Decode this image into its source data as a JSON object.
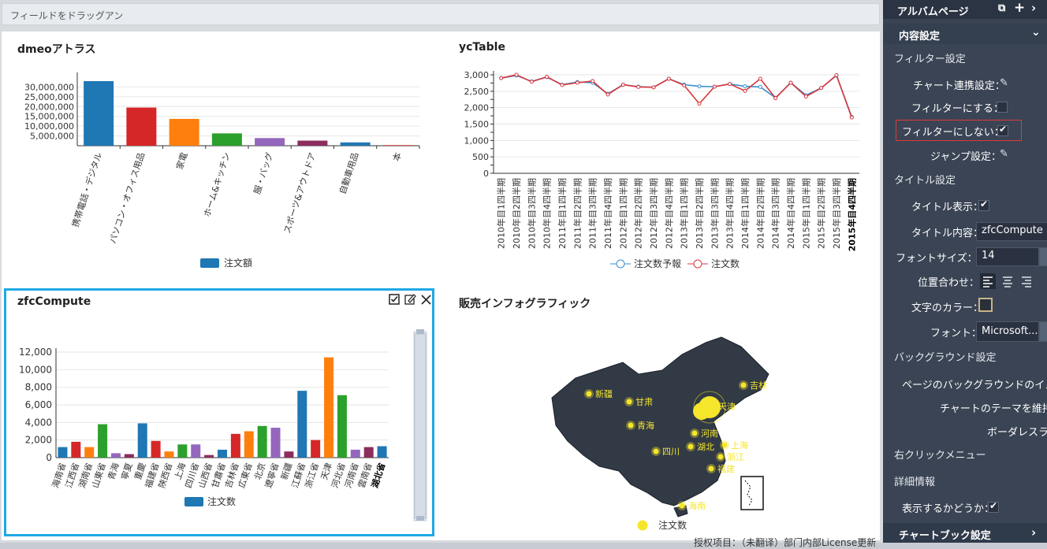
{
  "dropbar": {
    "label": "フィールドをドラッグアン"
  },
  "footer": {
    "text": "授权项目：（未翻译）部门内部License更新"
  },
  "widgets": {
    "w1": {
      "title": "dmeoアトラス",
      "legend": "注文額"
    },
    "w2": {
      "title": "ycTable",
      "legend_a": "注文数予報",
      "legend_b": "注文数"
    },
    "w3": {
      "title": "zfcCompute",
      "legend": "注文数"
    },
    "w4": {
      "title": "販売インフォグラフィック",
      "legend": "注文数"
    }
  },
  "chart_data": [
    {
      "type": "bar",
      "title": "dmeoアトラス",
      "categories": [
        "携帯電話・デジタル",
        "パソコン・オフィス用品",
        "家電",
        "ホーム&キッチン",
        "服・バッグ",
        "スポーツ&アウトドア",
        "自動車用品",
        "本"
      ],
      "values": [
        33000000,
        19500000,
        13700000,
        6300000,
        3900000,
        2600000,
        1700000,
        300000
      ],
      "colors": [
        "#1f77b4",
        "#d62728",
        "#ff7f0e",
        "#2ca02c",
        "#9467bd",
        "#8c2d5e",
        "#1f77b4",
        "#d62728"
      ],
      "yticks": [
        "5,000,000",
        "10,000,000",
        "15,000,000",
        "20,000,000",
        "25,000,000",
        "30,000,000"
      ],
      "ylim": [
        0,
        35000000
      ],
      "legend": [
        "注文額"
      ]
    },
    {
      "type": "line",
      "title": "ycTable",
      "categories": [
        "2010年目1四半期",
        "2010年目2四半期",
        "2010年目3四半期",
        "2010年目4四半期",
        "2011年目1四半期",
        "2011年目2四半期",
        "2011年目3四半期",
        "2011年目4四半期",
        "2012年目1四半期",
        "2012年目2四半期",
        "2012年目3四半期",
        "2012年目4四半期",
        "2013年目1四半期",
        "2013年目2四半期",
        "2013年目3四半期",
        "2013年目4四半期",
        "2014年目1四半期",
        "2014年目2四半期",
        "2014年目3四半期",
        "2014年目4四半期",
        "2015年目1四半期",
        "2015年目2四半期",
        "2015年目3四半期",
        "2015年目4四半期"
      ],
      "yticks": [
        "0",
        "250",
        "500",
        "750",
        "1,000",
        "1,250",
        "1,500",
        "1,750",
        "2,000",
        "2,250",
        "2,500",
        "2,750",
        "3,000"
      ],
      "ylim": [
        0,
        3000
      ],
      "series": [
        {
          "name": "注文数予報",
          "color": "#3a8fd1",
          "values": [
            2900,
            2980,
            2800,
            2930,
            2700,
            2780,
            2760,
            2420,
            2700,
            2640,
            2620,
            2880,
            2700,
            2650,
            2640,
            2720,
            2650,
            2630,
            2300,
            2760,
            2380,
            2600,
            2980,
            1720
          ]
        },
        {
          "name": "注文数",
          "color": "#d9373b",
          "values": [
            2900,
            3000,
            2790,
            2940,
            2690,
            2760,
            2810,
            2400,
            2700,
            2630,
            2620,
            2880,
            2680,
            2120,
            2640,
            2720,
            2510,
            2880,
            2290,
            2760,
            2340,
            2600,
            2990,
            1700
          ]
        }
      ],
      "legend": [
        "注文数予報",
        "注文数"
      ]
    },
    {
      "type": "bar",
      "title": "zfcCompute",
      "categories": [
        "海南省",
        "江西省",
        "湖南省",
        "山東省",
        "青海",
        "寧夏",
        "重慶",
        "福建省",
        "陝西省",
        "上海",
        "四川省",
        "山西省",
        "甘肅省",
        "吉林省",
        "広東省",
        "北京",
        "遼寧省",
        "新疆",
        "江蘇省",
        "浙江省",
        "天津",
        "河北省",
        "河南省",
        "雲南省",
        "湖北省"
      ],
      "values": [
        1200,
        1800,
        1200,
        3800,
        500,
        400,
        3900,
        1900,
        700,
        1500,
        1500,
        300,
        900,
        2700,
        3000,
        3600,
        3400,
        700,
        7600,
        2000,
        11400,
        7100,
        900,
        1200,
        1300
      ],
      "colors": [
        "#1f77b4",
        "#d62728",
        "#ff7f0e",
        "#2ca02c",
        "#9467bd",
        "#8c2d5e",
        "#1f77b4",
        "#d62728",
        "#ff7f0e",
        "#2ca02c",
        "#9467bd",
        "#8c2d5e",
        "#1f77b4",
        "#d62728",
        "#ff7f0e",
        "#2ca02c",
        "#9467bd",
        "#8c2d5e",
        "#1f77b4",
        "#d62728",
        "#ff7f0e",
        "#2ca02c",
        "#9467bd",
        "#8c2d5e",
        "#1f77b4"
      ],
      "yticks": [
        "0",
        "2,000",
        "4,000",
        "6,000",
        "8,000",
        "10,000",
        "12,000"
      ],
      "ylim": [
        0,
        12000
      ],
      "legend": [
        "注文数"
      ]
    }
  ],
  "map": {
    "labels": [
      "新疆",
      "甘肃",
      "青海",
      "四川",
      "湖北",
      "河南",
      "上海",
      "浙江",
      "福建",
      "海南",
      "吉林",
      "天津"
    ]
  },
  "panel": {
    "album": "アルバムページ",
    "content": "内容設定",
    "filter_section": "フィルター設定",
    "chart_link": "チャート連携設定：",
    "filter_on": "フィルターにする：",
    "filter_off": "フィルターにしない：",
    "jump": "ジャンプ設定：",
    "title_section": "タイトル設定",
    "title_show": "タイトル表示：",
    "title_content": "タイトル内容：",
    "title_value": "zfcCompute",
    "font_size": "フォントサイズ：",
    "font_size_value": "14",
    "align": "位置合わせ：",
    "text_color": "文字のカラー：",
    "font": "フォント：",
    "font_value": "Microsoft...",
    "bg_section": "バックグラウンド設定",
    "bg_image": "ページのバックグラウンドのイメ",
    "theme": "チャートのテーマを維持",
    "borderless": "ボーダレスラ",
    "rclick": "右クリックメニュー",
    "detail": "詳細情報",
    "show": "表示するかどうか：",
    "chartbook": "チャートブック設定"
  }
}
